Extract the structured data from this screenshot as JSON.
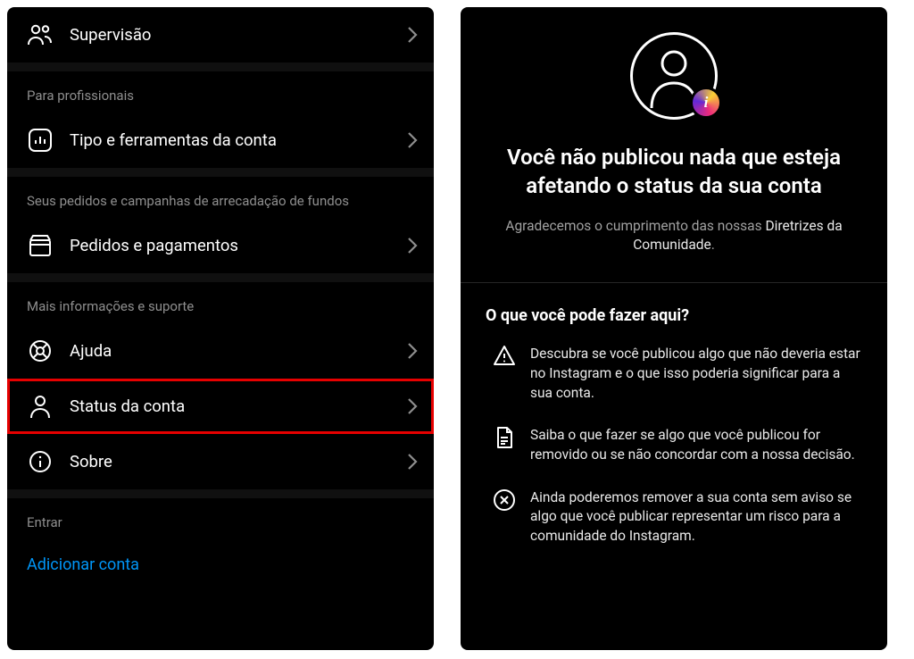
{
  "left": {
    "supervision_label": "Supervisão",
    "section_pro": "Para profissionais",
    "tools_label": "Tipo e ferramentas da conta",
    "section_fund": "Seus pedidos e campanhas de arrecadação de fundos",
    "orders_label": "Pedidos e pagamentos",
    "section_info": "Mais informações e suporte",
    "help_label": "Ajuda",
    "status_label": "Status da conta",
    "about_label": "Sobre",
    "section_login": "Entrar",
    "add_account": "Adicionar conta"
  },
  "right": {
    "hero_title": "Você não publicou nada que esteja afetando o status da sua conta",
    "hero_sub_prefix": "Agradecemos o cumprimento das nossas ",
    "hero_sub_bold": "Diretrizes da Comunidade",
    "what_title": "O que você pode fazer aqui?",
    "items": [
      "Descubra se você publicou algo que não deveria estar no Instagram e o que isso poderia significar para a sua conta.",
      "Saiba o que fazer se algo que você publicou for removido ou se não concordar com a nossa decisão.",
      "Ainda poderemos remover a sua conta sem aviso se algo que você publicar representar um risco para a comunidade do Instagram."
    ]
  }
}
